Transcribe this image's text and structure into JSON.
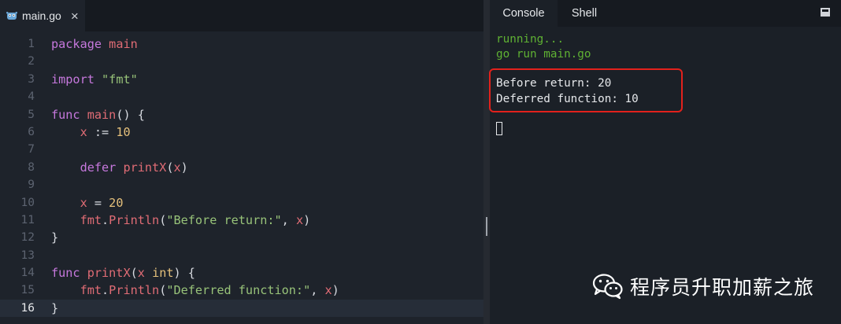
{
  "editor": {
    "tab": {
      "filename": "main.go",
      "close_glyph": "×",
      "icon": "gopher-file-icon"
    },
    "lines": [
      {
        "n": "1",
        "tokens": [
          [
            "kw",
            "package"
          ],
          [
            "plain",
            " "
          ],
          [
            "fn",
            "main"
          ]
        ]
      },
      {
        "n": "2",
        "tokens": []
      },
      {
        "n": "3",
        "tokens": [
          [
            "kw",
            "import"
          ],
          [
            "plain",
            " "
          ],
          [
            "str",
            "\"fmt\""
          ]
        ]
      },
      {
        "n": "4",
        "tokens": []
      },
      {
        "n": "5",
        "tokens": [
          [
            "kw",
            "func"
          ],
          [
            "plain",
            " "
          ],
          [
            "fn",
            "main"
          ],
          [
            "plain",
            "() {"
          ]
        ]
      },
      {
        "n": "6",
        "tokens": [
          [
            "plain",
            "    "
          ],
          [
            "var",
            "x"
          ],
          [
            "plain",
            " := "
          ],
          [
            "num",
            "10"
          ]
        ]
      },
      {
        "n": "7",
        "tokens": []
      },
      {
        "n": "8",
        "tokens": [
          [
            "plain",
            "    "
          ],
          [
            "kw",
            "defer"
          ],
          [
            "plain",
            " "
          ],
          [
            "fn",
            "printX"
          ],
          [
            "plain",
            "("
          ],
          [
            "var",
            "x"
          ],
          [
            "plain",
            ")"
          ]
        ]
      },
      {
        "n": "9",
        "tokens": []
      },
      {
        "n": "10",
        "tokens": [
          [
            "plain",
            "    "
          ],
          [
            "var",
            "x"
          ],
          [
            "plain",
            " = "
          ],
          [
            "num",
            "20"
          ]
        ]
      },
      {
        "n": "11",
        "tokens": [
          [
            "plain",
            "    "
          ],
          [
            "fn",
            "fmt"
          ],
          [
            "plain",
            "."
          ],
          [
            "fn",
            "Println"
          ],
          [
            "plain",
            "("
          ],
          [
            "str",
            "\"Before return:\""
          ],
          [
            "plain",
            ", "
          ],
          [
            "var",
            "x"
          ],
          [
            "plain",
            ")"
          ]
        ]
      },
      {
        "n": "12",
        "tokens": [
          [
            "plain",
            "}"
          ]
        ]
      },
      {
        "n": "13",
        "tokens": []
      },
      {
        "n": "14",
        "tokens": [
          [
            "kw",
            "func"
          ],
          [
            "plain",
            " "
          ],
          [
            "fn",
            "printX"
          ],
          [
            "plain",
            "("
          ],
          [
            "var",
            "x"
          ],
          [
            "plain",
            " "
          ],
          [
            "num",
            "int"
          ],
          [
            "plain",
            ") {"
          ]
        ]
      },
      {
        "n": "15",
        "tokens": [
          [
            "plain",
            "    "
          ],
          [
            "fn",
            "fmt"
          ],
          [
            "plain",
            "."
          ],
          [
            "fn",
            "Println"
          ],
          [
            "plain",
            "("
          ],
          [
            "str",
            "\"Deferred function:\""
          ],
          [
            "plain",
            ", "
          ],
          [
            "var",
            "x"
          ],
          [
            "plain",
            ")"
          ]
        ]
      },
      {
        "n": "16",
        "tokens": [
          [
            "plain",
            "}"
          ]
        ],
        "active": true
      }
    ]
  },
  "console": {
    "tabs": [
      {
        "label": "Console",
        "active": true
      },
      {
        "label": "Shell",
        "active": false
      }
    ],
    "status_lines": [
      "running...",
      "go run main.go"
    ],
    "output_lines": [
      "Before return: 20",
      "Deferred function: 10"
    ]
  },
  "watermark": {
    "text": "程序员升职加薪之旅",
    "icon": "wechat-icon"
  },
  "colors": {
    "editor_bg": "#1e232b",
    "console_bg": "#1b2027",
    "keyword": "#c678dd",
    "identifier": "#e06c75",
    "number": "#e5c07b",
    "string": "#98c379",
    "console_green": "#5fb133",
    "highlight_red": "#e2211c"
  }
}
